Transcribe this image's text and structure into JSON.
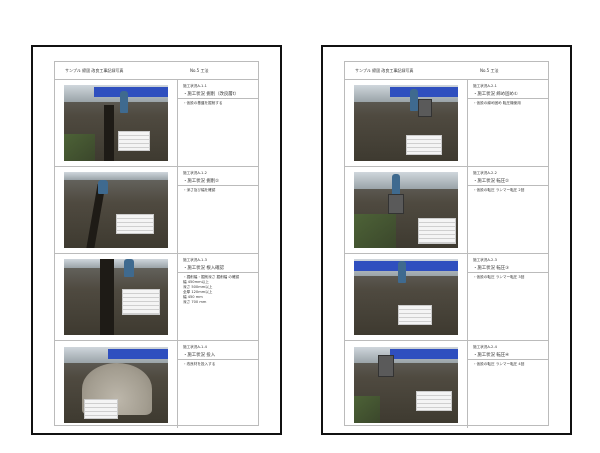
{
  "left": {
    "header_title": "サンプル 締固 改良工事記録写真",
    "header_tag": "No.5 工法",
    "rows": [
      {
        "item": "施工状況A-1-1",
        "title": "・施工状況 掘削（改良層t）",
        "note": "・仮設の基盤を掘削する",
        "spec": []
      },
      {
        "item": "施工状況A-1-2",
        "title": "・施工状況 掘削②",
        "note": "・深さ及び幅を確認",
        "spec": []
      },
      {
        "item": "施工状況A-1-3",
        "title": "・施工状況 根入確認",
        "note": "・掘削幅・掘削深さ 掘削幅 の確認",
        "spec": [
          "幅 450mm以上",
          "深さ 500mm以上",
          "全厚 120mm以上",
          "幅 450 mm",
          "深さ 700 mm"
        ]
      },
      {
        "item": "施工状況A-1-4",
        "title": "・施工状況 投入",
        "note": "・改良材を投入する",
        "spec": []
      }
    ]
  },
  "right": {
    "header_title": "サンプル 締固 改良工事記録写真",
    "header_tag": "No.5 工法",
    "rows": [
      {
        "item": "施工状況A-2-1",
        "title": "・施工状況 締め固め①",
        "note": "・仮設の締め固め 転圧機使用",
        "spec": []
      },
      {
        "item": "施工状況A-2-2",
        "title": "・施工状況 転圧②",
        "note": "・仮設の転圧 ランマー転圧 2回",
        "spec": []
      },
      {
        "item": "施工状況A-2-3",
        "title": "・施工状況 転圧③",
        "note": "・仮設の転圧 ランマー転圧 3回",
        "spec": []
      },
      {
        "item": "施工状況A-2-4",
        "title": "・施工状況 転圧④",
        "note": "・仮設の転圧 ランマー転圧 4回",
        "spec": []
      }
    ]
  }
}
